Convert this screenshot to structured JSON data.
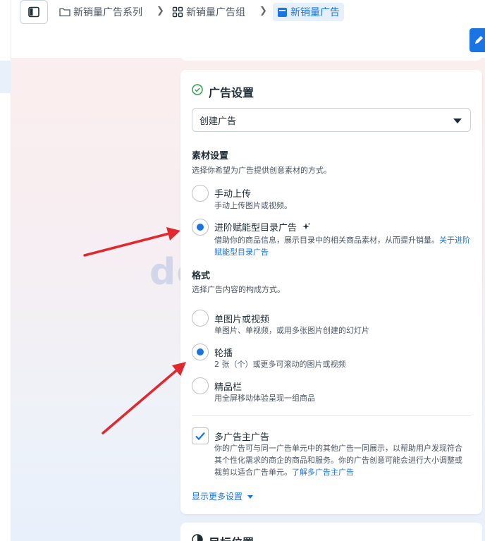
{
  "breadcrumb": {
    "campaign": "新销量广告系列",
    "adset": "新销量广告组",
    "ad": "新销量广告"
  },
  "ad_settings": {
    "title": "广告设置",
    "select_value": "创建广告"
  },
  "creative_setup": {
    "title": "素材设置",
    "description": "选择你希望为广告提供创意素材的方式。",
    "options": [
      {
        "label": "手动上传",
        "desc": "手动上传图片或视频。",
        "selected": false
      },
      {
        "label": "进阶赋能型目录广告",
        "desc": "借助你的商品信息，展示目录中的相关商品素材，从而提升销量。",
        "link": "关于进阶赋能型目录广告",
        "selected": true
      }
    ]
  },
  "format": {
    "title": "格式",
    "description": "选择广告内容的构成方式。",
    "options": [
      {
        "label": "单图片或视频",
        "desc": "单图片、单视频，或用多张图片创建的幻灯片",
        "selected": false
      },
      {
        "label": "轮播",
        "desc": "2 张（个）或更多可滚动的图片或视频",
        "selected": true
      },
      {
        "label": "精品栏",
        "desc": "用全屏移动体验呈现一组商品",
        "selected": false
      }
    ]
  },
  "multi_advertiser": {
    "label": "多广告主广告",
    "desc": "你的广告可与同一广告单元中的其他广告一同展示，以帮助用户发现符合其个性化需求的商企的商品和服务。你的广告创意可能会进行大小调整或裁剪以适合广告单元。",
    "link": "了解多广告主广告",
    "checked": true
  },
  "show_more": "显示更多设置",
  "next_section": {
    "title": "目标位置"
  },
  "watermark": "doingfb",
  "colors": {
    "accent": "#1b74e4",
    "arrow": "#e0282e"
  }
}
